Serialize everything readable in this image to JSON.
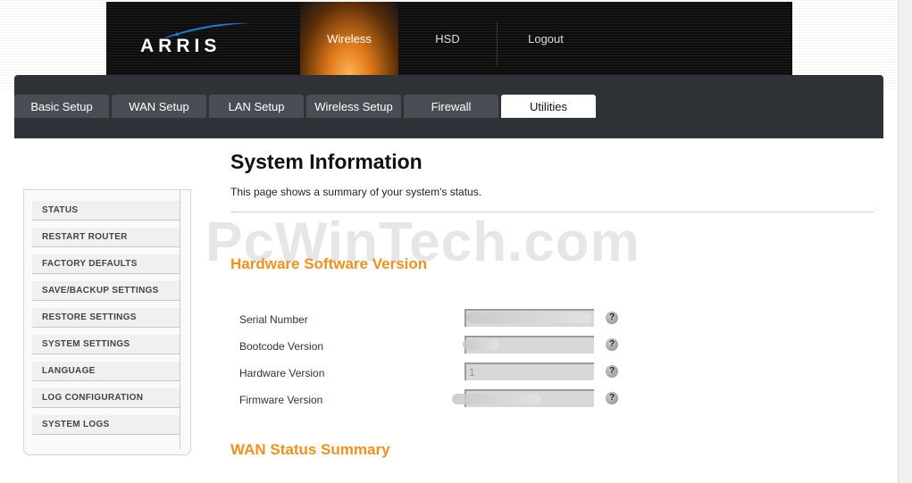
{
  "brand": {
    "logo_text": "ARRIS"
  },
  "top_nav": [
    {
      "label": "Wireless",
      "active": true
    },
    {
      "label": "HSD",
      "active": false
    },
    {
      "label": "Logout",
      "active": false
    }
  ],
  "tabs": [
    {
      "label": "Basic Setup",
      "active": false
    },
    {
      "label": "WAN Setup",
      "active": false
    },
    {
      "label": "LAN Setup",
      "active": false
    },
    {
      "label": "Wireless Setup",
      "active": false
    },
    {
      "label": "Firewall",
      "active": false
    },
    {
      "label": "Utilities",
      "active": true
    }
  ],
  "sidebar": {
    "items": [
      {
        "label": "STATUS"
      },
      {
        "label": "RESTART ROUTER"
      },
      {
        "label": "FACTORY DEFAULTS"
      },
      {
        "label": "SAVE/BACKUP SETTINGS"
      },
      {
        "label": "RESTORE SETTINGS"
      },
      {
        "label": "SYSTEM SETTINGS"
      },
      {
        "label": "LANGUAGE"
      },
      {
        "label": "LOG CONFIGURATION"
      },
      {
        "label": "SYSTEM LOGS"
      }
    ]
  },
  "main": {
    "title": "System Information",
    "description": "This page shows a summary of your system's status.",
    "watermark": "PcWinTech.com",
    "hw_section_title": "Hardware Software Version",
    "fields": [
      {
        "label": "Serial Number",
        "value": ""
      },
      {
        "label": "Bootcode Version",
        "value": ""
      },
      {
        "label": "Hardware Version",
        "value": "1"
      },
      {
        "label": "Firmware Version",
        "value": ""
      }
    ],
    "help_glyph": "?",
    "wan_section_title": "WAN Status Summary"
  },
  "colors": {
    "accent_orange": "#f0901e",
    "panel_dark": "#2f3338",
    "tab_inactive": "#4a4e54"
  }
}
